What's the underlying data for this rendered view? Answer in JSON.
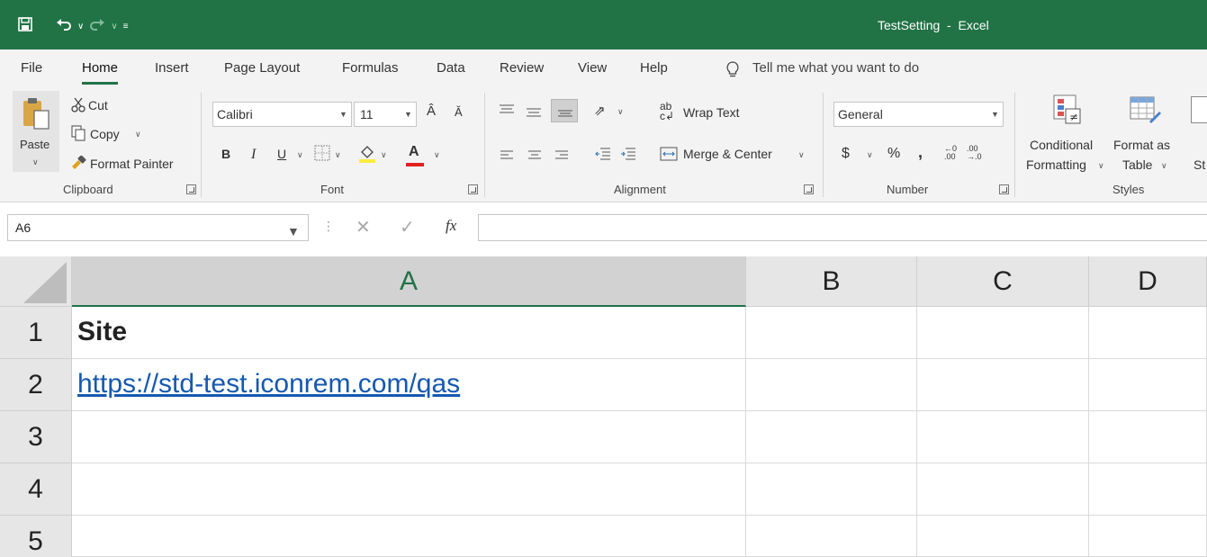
{
  "title": "TestSetting  -  Excel",
  "menu": {
    "tabs": [
      "File",
      "Home",
      "Insert",
      "Page Layout",
      "Formulas",
      "Data",
      "Review",
      "View",
      "Help"
    ],
    "tell_me": "Tell me what you want to do"
  },
  "ribbon": {
    "clipboard": {
      "paste": "Paste",
      "cut": "Cut",
      "copy": "Copy",
      "format_painter": "Format Painter",
      "label": "Clipboard"
    },
    "font": {
      "name": "Calibri",
      "size": "11",
      "bold": "B",
      "italic": "I",
      "underline": "U",
      "font_color": "A",
      "label": "Font"
    },
    "alignment": {
      "wrap_text": "Wrap Text",
      "merge_center": "Merge & Center",
      "label": "Alignment"
    },
    "number": {
      "format": "General",
      "currency": "$",
      "percent": "%",
      "comma": ",",
      "label": "Number"
    },
    "styles": {
      "conditional_1": "Conditional",
      "conditional_2": "Formatting",
      "format_as_1": "Format as",
      "format_as_2": "Table",
      "cell_styles_cut": "St",
      "label": "Styles"
    }
  },
  "formula_bar": {
    "name_box": "A6",
    "fx": "fx",
    "value": ""
  },
  "sheet": {
    "columns": [
      "A",
      "B",
      "C",
      "D"
    ],
    "rows": [
      "1",
      "2",
      "3",
      "4",
      "5"
    ],
    "cells": {
      "A1": "Site",
      "A2": "https://std-test.iconrem.com/qas"
    }
  },
  "colors": {
    "accent": "#217346",
    "link": "#1558b0"
  }
}
